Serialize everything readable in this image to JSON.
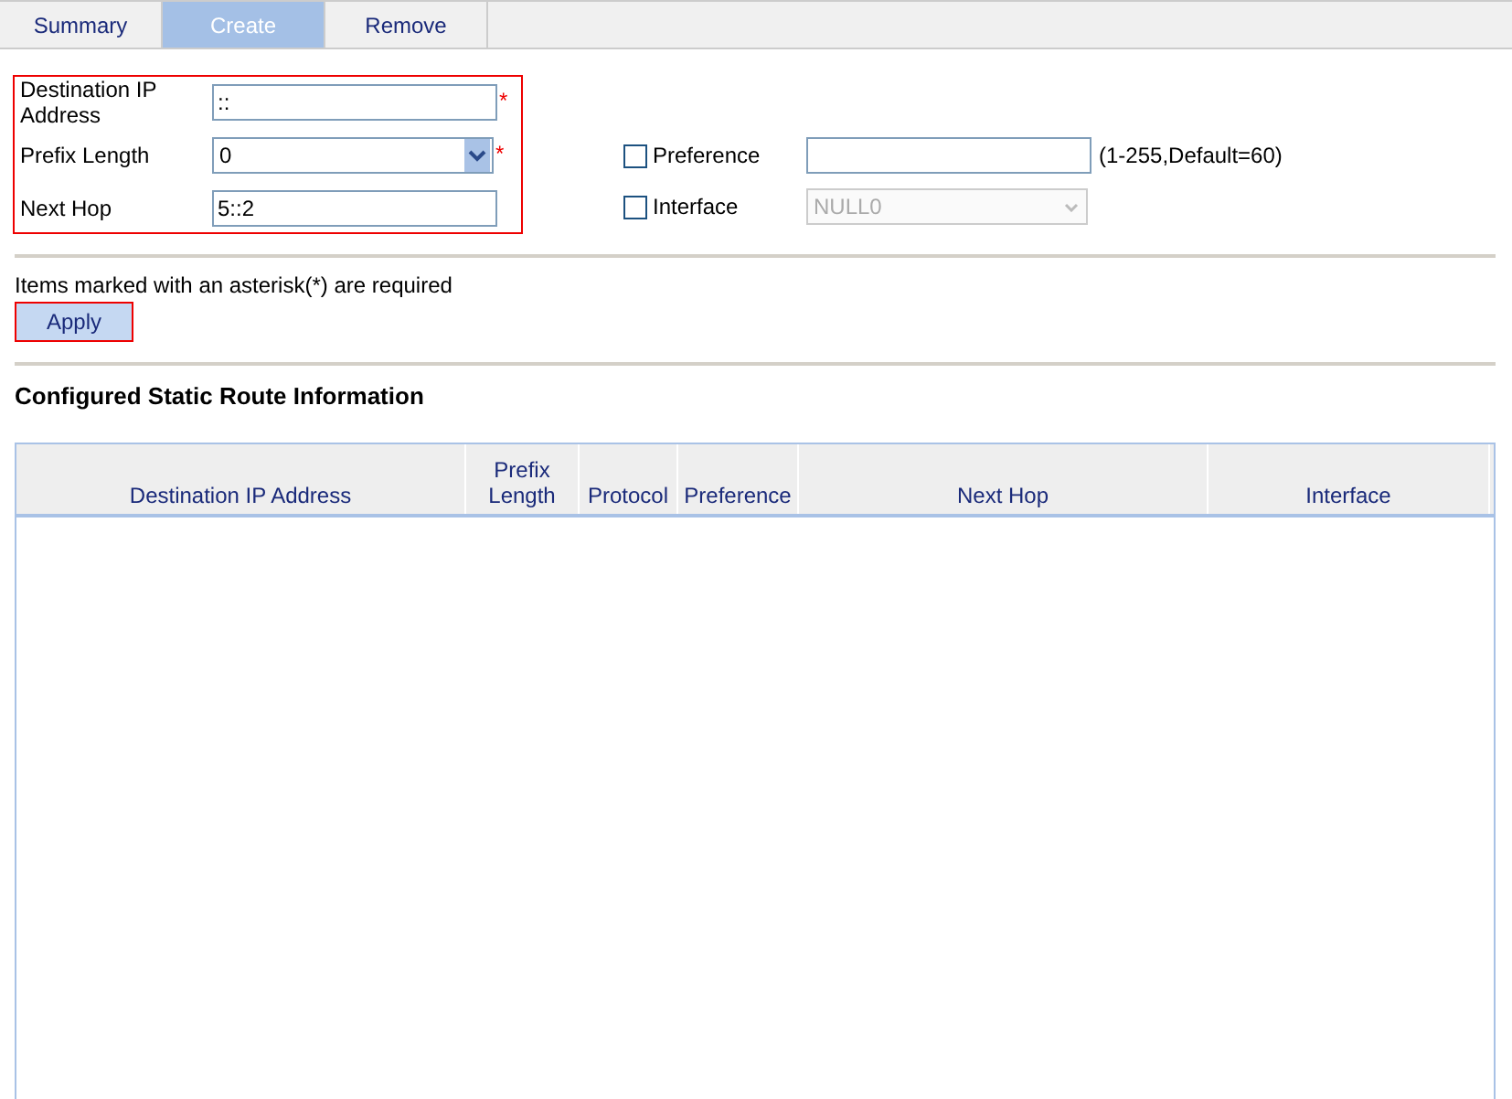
{
  "tabs": [
    {
      "label": "Summary",
      "selected": false
    },
    {
      "label": "Create",
      "selected": true
    },
    {
      "label": "Remove",
      "selected": false
    }
  ],
  "form": {
    "destination": {
      "label": "Destination IP Address",
      "value": "::",
      "required_mark": "*"
    },
    "prefix_length": {
      "label": "Prefix Length",
      "value": "0",
      "required_mark": "*"
    },
    "next_hop": {
      "label": "Next Hop",
      "value": "5::2"
    },
    "preference": {
      "label": "Preference",
      "checked": false,
      "hint": "(1-255,Default=60)"
    },
    "interface": {
      "label": "Interface",
      "checked": false,
      "value": "NULL0",
      "disabled": true
    }
  },
  "required_note": "Items marked with an asterisk(*) are required",
  "apply_button": "Apply",
  "section_title": "Configured Static Route Information",
  "table": {
    "columns": [
      {
        "label": "Destination IP Address"
      },
      {
        "label": "Prefix Length"
      },
      {
        "label": "Protocol"
      },
      {
        "label": "Preference"
      },
      {
        "label": "Next Hop"
      },
      {
        "label": "Interface"
      }
    ]
  }
}
